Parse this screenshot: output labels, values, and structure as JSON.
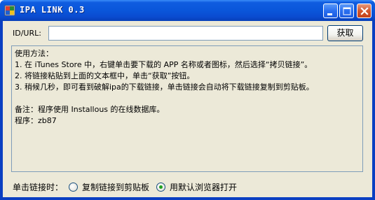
{
  "window": {
    "title": "IPA LINK 0.3",
    "icon": "app-icon",
    "controls": [
      "minimize-icon",
      "maximize-icon",
      "close-icon"
    ]
  },
  "url_row": {
    "label": "ID/URL:",
    "value": "",
    "placeholder": "",
    "fetch_label": "获取"
  },
  "info": {
    "lines": [
      "使用方法：",
      "1. 在 iTunes Store 中，右键单击要下载的 APP 名称或者图标，然后选择“拷贝链接”。",
      "2. 将链接粘贴到上面的文本框中，单击“获取”按钮。",
      "3. 稍候几秒，即可看到破解ipa的下载链接，单击链接会自动将下载链接复制到剪贴板。",
      "",
      "备注：程序使用 Installous 的在线数据库。",
      "程序：zb87"
    ]
  },
  "click_option": {
    "label": "单击链接时：",
    "options": [
      {
        "label": "复制链接到剪贴板",
        "checked": false
      },
      {
        "label": "用默认浏览器打开",
        "checked": true
      }
    ]
  }
}
